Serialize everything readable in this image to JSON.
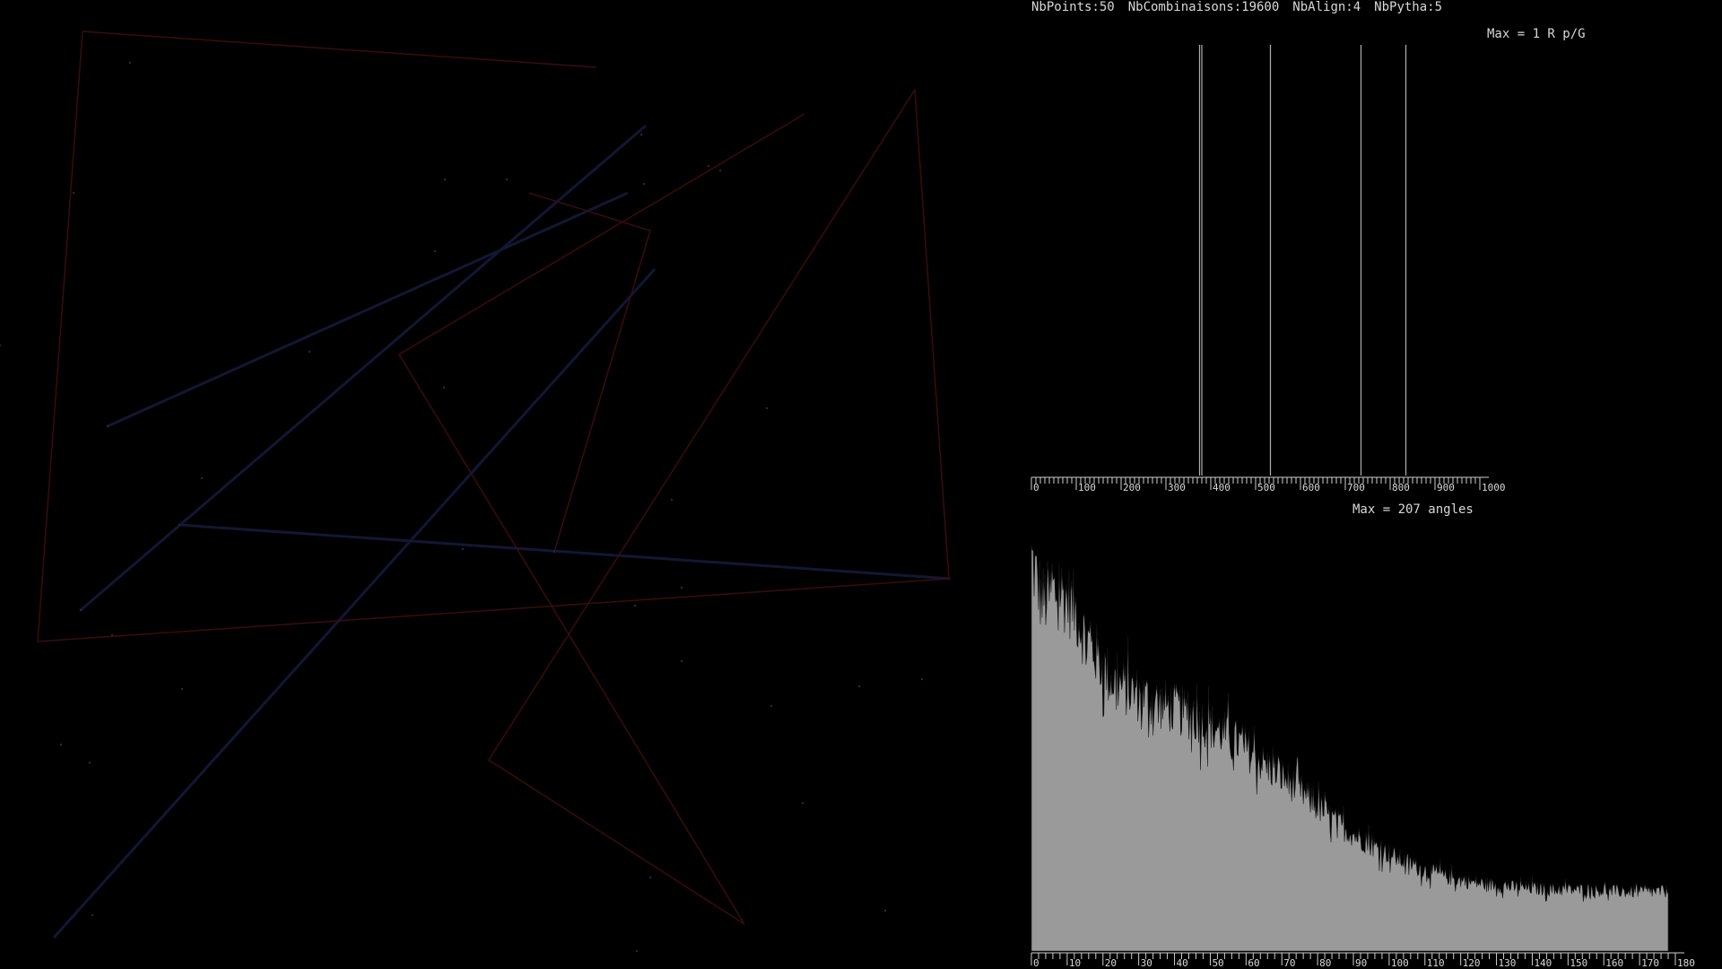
{
  "stats": {
    "points": "NbPoints:50",
    "combinations": "NbCombinaisons:19600",
    "align": "NbAlign:4",
    "pytha": "NbPytha:5"
  },
  "ratio_max_label": "Max = 1 R p/G",
  "angle_max_label": "Max = 207 angles",
  "colors": {
    "background": "#000000",
    "text": "#d8d8d8",
    "bars": "#9a9a9a",
    "lines": "#b0b0b0",
    "ticks": "#d0d0d0"
  },
  "chart_data": [
    {
      "type": "bar",
      "title": "Max = 1 R p/G",
      "xlim": [
        0,
        1000
      ],
      "ylim": [
        0,
        1
      ],
      "x": [
        375,
        380,
        533,
        735,
        835
      ],
      "values": [
        1,
        1,
        1,
        1,
        1
      ],
      "tick_labels": [
        "0",
        "100",
        "200",
        "300",
        "400",
        "500",
        "600",
        "700",
        "800",
        "900",
        "1000"
      ]
    },
    {
      "type": "bar",
      "title": "Max = 207 angles",
      "xlim": [
        0,
        180
      ],
      "ylim": [
        0,
        207
      ],
      "max": 207,
      "tick_labels": [
        "0",
        "10",
        "20",
        "30",
        "40",
        "50",
        "60",
        "70",
        "80",
        "90",
        "100",
        "110",
        "120",
        "130",
        "140",
        "150",
        "160",
        "170",
        "180"
      ],
      "profile_x": [
        0,
        3,
        8,
        12,
        15,
        18,
        22,
        28,
        35,
        42,
        50,
        58,
        65,
        72,
        80,
        88,
        95,
        102,
        110,
        118,
        125,
        135,
        145,
        155,
        165,
        178
      ],
      "profile_y": [
        185,
        165,
        170,
        162,
        148,
        140,
        128,
        122,
        117,
        113,
        106,
        98,
        88,
        80,
        68,
        57,
        50,
        44,
        38,
        34,
        32,
        30,
        29,
        29,
        28,
        28
      ]
    }
  ]
}
